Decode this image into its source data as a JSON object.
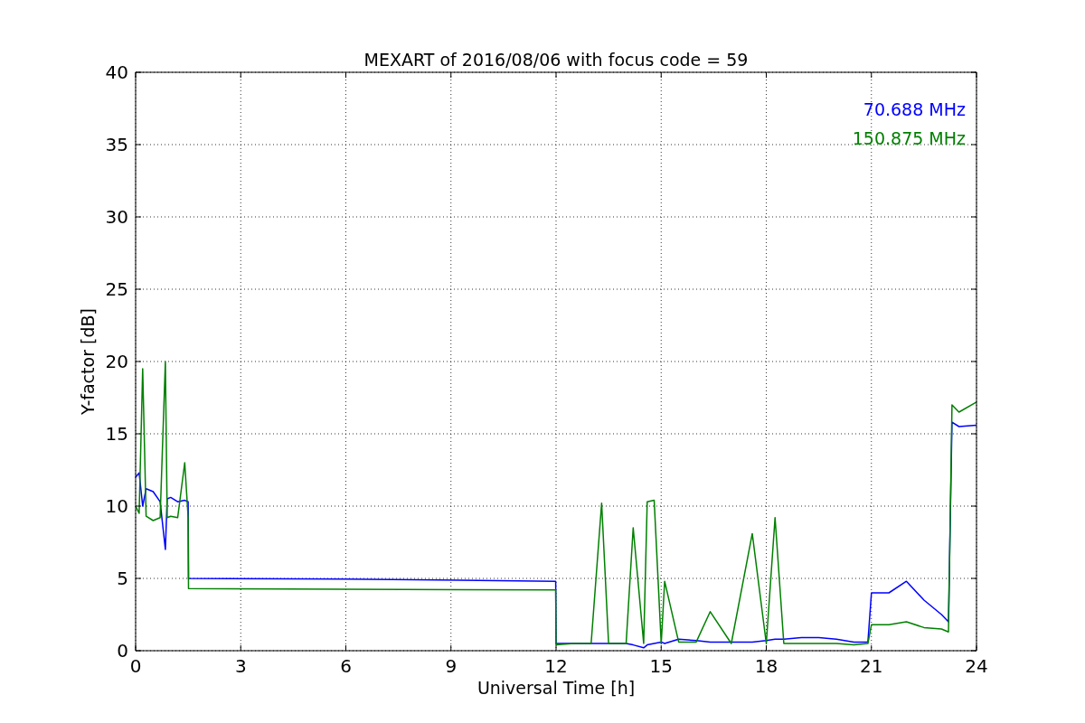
{
  "figure": {
    "chart_data": {
      "type": "line",
      "title": "MEXART of 2016/08/06 with focus code = 59",
      "xlabel": "Universal Time [h]",
      "ylabel": "Y-factor [dB]",
      "x": [
        0,
        0.1,
        0.2,
        0.3,
        0.5,
        0.7,
        0.85,
        0.9,
        1.0,
        1.2,
        1.4,
        1.5,
        1.51,
        6,
        11.99,
        12.0,
        12.5,
        13.0,
        13.3,
        13.5,
        14.0,
        14.2,
        14.5,
        14.6,
        14.8,
        15.0,
        15.1,
        15.5,
        16.0,
        16.4,
        17.0,
        17.6,
        18.0,
        18.25,
        18.5,
        19.0,
        19.5,
        20.0,
        20.5,
        20.9,
        21.0,
        21.5,
        22.0,
        22.5,
        23.0,
        23.2,
        23.3,
        23.5,
        24
      ],
      "series": [
        {
          "name": "70.688 MHz",
          "color": "#0000ff",
          "values": [
            12,
            12.3,
            10,
            11.2,
            11,
            10.3,
            7,
            10.5,
            10.6,
            10.3,
            10.4,
            10.3,
            5.0,
            4.95,
            4.8,
            0.5,
            0.5,
            0.5,
            0.5,
            0.5,
            0.5,
            0.4,
            0.2,
            0.4,
            0.5,
            0.6,
            0.5,
            0.8,
            0.7,
            0.6,
            0.6,
            0.6,
            0.7,
            0.8,
            0.8,
            0.9,
            0.9,
            0.8,
            0.6,
            0.6,
            4.0,
            4.0,
            4.8,
            3.5,
            2.5,
            2.0,
            15.8,
            15.5,
            15.6
          ]
        },
        {
          "name": "150.875 MHz",
          "color": "#008000",
          "values": [
            10,
            9.5,
            19.5,
            9.3,
            9,
            9.2,
            20,
            9.2,
            9.3,
            9.2,
            13,
            9.2,
            4.3,
            4.25,
            4.2,
            0.4,
            0.5,
            0.5,
            10.2,
            0.5,
            0.5,
            8.5,
            0.5,
            10.3,
            10.4,
            0.5,
            4.8,
            0.6,
            0.6,
            2.7,
            0.5,
            8.1,
            0.5,
            9.2,
            0.5,
            0.5,
            0.5,
            0.5,
            0.4,
            0.5,
            1.8,
            1.8,
            2.0,
            1.6,
            1.5,
            1.3,
            17,
            16.5,
            17.2
          ]
        }
      ],
      "xlim": [
        0,
        24
      ],
      "ylim": [
        0,
        40
      ],
      "grid": true,
      "xticks": [
        0,
        3,
        6,
        9,
        12,
        15,
        18,
        21,
        24
      ],
      "yticks": [
        0,
        5,
        10,
        15,
        20,
        25,
        30,
        35,
        40
      ]
    }
  }
}
